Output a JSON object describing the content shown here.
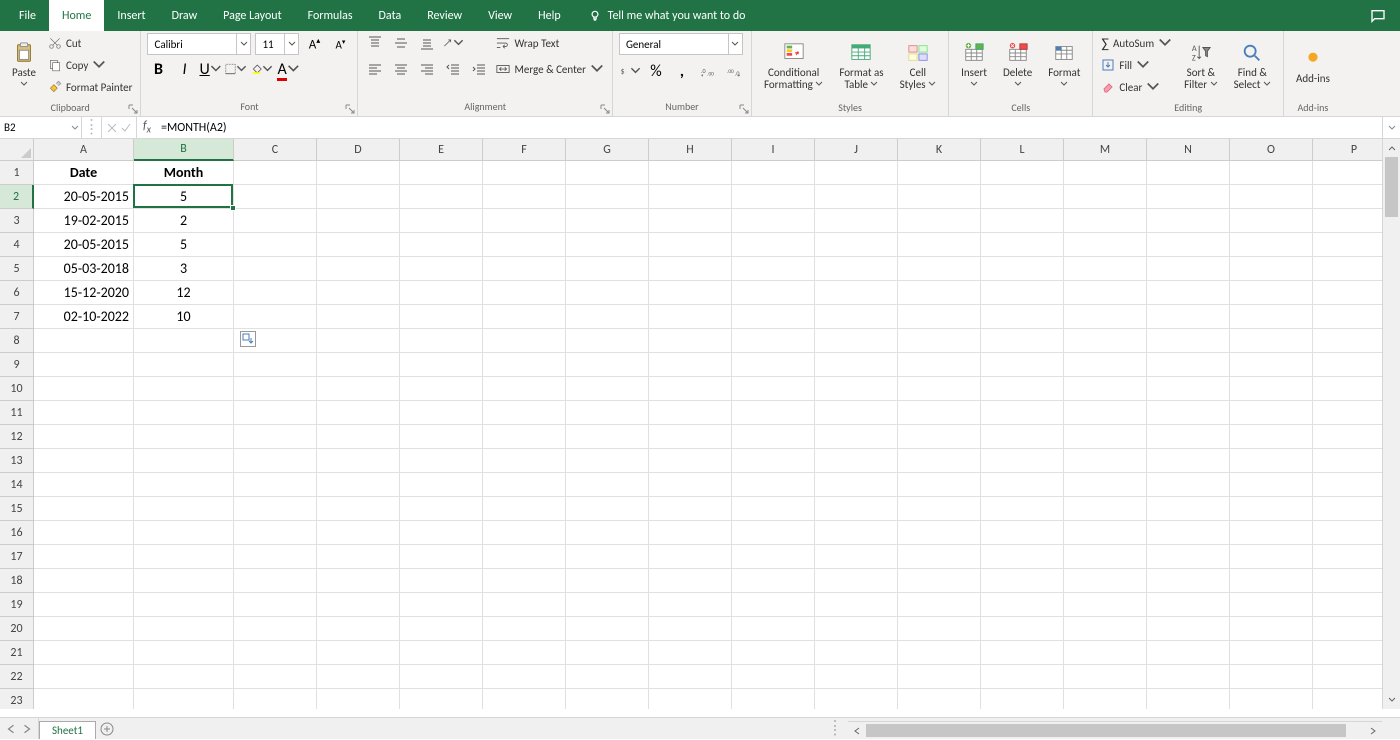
{
  "app": {
    "tell_me_placeholder": "Tell me what you want to do"
  },
  "tabs": [
    "File",
    "Home",
    "Insert",
    "Draw",
    "Page Layout",
    "Formulas",
    "Data",
    "Review",
    "View",
    "Help"
  ],
  "active_tab": "Home",
  "ribbon": {
    "clipboard": {
      "paste": "Paste",
      "cut": "Cut",
      "copy": "Copy",
      "format_painter": "Format Painter",
      "label": "Clipboard"
    },
    "font": {
      "name": "Calibri",
      "size": "11",
      "label": "Font"
    },
    "alignment": {
      "wrap": "Wrap Text",
      "merge": "Merge & Center",
      "label": "Alignment"
    },
    "number": {
      "format": "General",
      "label": "Number"
    },
    "styles": {
      "cond": "Conditional\nFormatting",
      "table": "Format as\nTable",
      "cell": "Cell\nStyles",
      "label": "Styles"
    },
    "cells": {
      "insert": "Insert",
      "delete": "Delete",
      "format": "Format",
      "label": "Cells"
    },
    "editing": {
      "autosum": "AutoSum",
      "fill": "Fill",
      "clear": "Clear",
      "sort": "Sort &\nFilter",
      "find": "Find &\nSelect",
      "label": "Editing"
    },
    "addins": {
      "addins": "Add-ins",
      "label": "Add-ins"
    }
  },
  "namebox": "B2",
  "formula": "=MONTH(A2)",
  "columns": [
    "A",
    "B",
    "C",
    "D",
    "E",
    "F",
    "G",
    "H",
    "I",
    "J",
    "K",
    "L",
    "M",
    "N",
    "O",
    "P"
  ],
  "col_widths": {
    "A": 100,
    "B": 100
  },
  "default_col_width": 83,
  "row_count": 23,
  "selected_cell": {
    "row": 2,
    "col": "B"
  },
  "headers": {
    "A": "Date",
    "B": "Month"
  },
  "data": [
    {
      "A": "20-05-2015",
      "B": "5"
    },
    {
      "A": "19-02-2015",
      "B": "2"
    },
    {
      "A": "20-05-2015",
      "B": "5"
    },
    {
      "A": "05-03-2018",
      "B": "3"
    },
    {
      "A": "15-12-2020",
      "B": "12"
    },
    {
      "A": "02-10-2022",
      "B": "10"
    }
  ],
  "sheet": {
    "name": "Sheet1"
  }
}
